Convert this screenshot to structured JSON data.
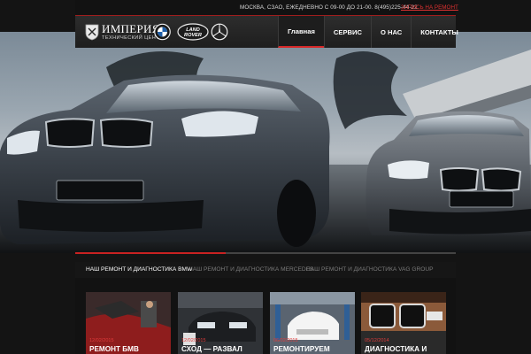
{
  "topbar": {
    "info": "МОСКВА, СЗАО, ЕЖЕДНЕВНО С 09-00 ДО 21-00. 8(495)225-44-22",
    "cta": "ЗАПИСЬ НА РЕМОНТ"
  },
  "logo": {
    "title": "ИМПЕРИЯ",
    "subtitle": "ТЕХНИЧЕСКИЙ ЦЕНТР",
    "brands": [
      "BMW",
      "LAND ROVER",
      "Mercedes-Benz"
    ],
    "land_rover_line1": "LAND",
    "land_rover_line2": "ROVER"
  },
  "nav": {
    "items": [
      {
        "label": "Главная",
        "active": true
      },
      {
        "label": "СЕРВИС",
        "active": false
      },
      {
        "label": "О НАС",
        "active": false
      },
      {
        "label": "КОНТАКТЫ",
        "active": false
      }
    ]
  },
  "hero": {
    "slides": 3,
    "active_slide": 1
  },
  "tabs": [
    {
      "label": "НАШ РЕМОНТ И ДИАГНОСТИКА BMW",
      "active": true
    },
    {
      "label": "НАШ РЕМОНТ И ДИАГНОСТИКА MERCEDES",
      "active": false
    },
    {
      "label": "НАШ РЕМОНТ И ДИАГНОСТИКА VAG GROUP",
      "active": false
    }
  ],
  "cards": [
    {
      "date": "12/02/2015",
      "title": "РЕМОНТ БМВ"
    },
    {
      "date": "12/02/2015",
      "title": "СХОД — РАЗВАЛ"
    },
    {
      "date": "06/02/2015",
      "title": "РЕМОНТИРУЕМ"
    },
    {
      "date": "05/12/2014",
      "title": "ДИАГНОСТИКА И"
    }
  ],
  "colors": {
    "accent": "#d62828",
    "background": "#141414",
    "header": "#252525"
  }
}
